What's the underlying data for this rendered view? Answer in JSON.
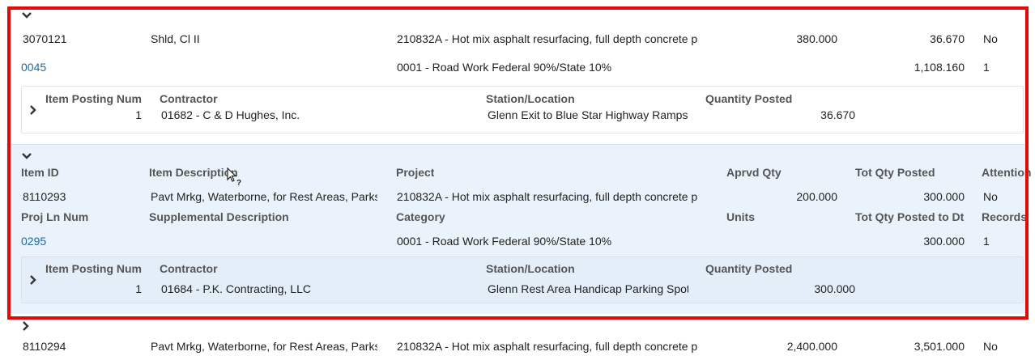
{
  "expand_glyph": "⌄",
  "collapse_glyph": "›",
  "rows": [
    {
      "item_id": "3070121",
      "item_description": "Shld, Cl II",
      "project": "210832A - Hot mix asphalt resurfacing, full depth concrete p",
      "aprvd_qty": "380.000",
      "tot_qty_posted": "36.670",
      "attention": "No",
      "proj_ln_num": "0045",
      "supplemental_description": "",
      "category": "0001 - Road Work Federal 90%/State 10%",
      "units": "",
      "tot_qty_posted_to_dt": "1,108.160",
      "records": "1",
      "posting": {
        "item_posting_num": "1",
        "contractor": "01682 - C & D Hughes, Inc.",
        "station_location": "Glenn Exit to Blue Star Highway Ramps",
        "quantity_posted": "36.670"
      }
    },
    {
      "item_id": "8110293",
      "item_description": "Pavt Mrkg, Waterborne, for Rest Areas, Parks",
      "project": "210832A - Hot mix asphalt resurfacing, full depth concrete p",
      "aprvd_qty": "200.000",
      "tot_qty_posted": "300.000",
      "attention": "No",
      "proj_ln_num": "0295",
      "supplemental_description": "",
      "category": "0001 - Road Work Federal 90%/State 10%",
      "units": "",
      "tot_qty_posted_to_dt": "300.000",
      "records": "1",
      "posting": {
        "item_posting_num": "1",
        "contractor": "01684 - P.K. Contracting, LLC",
        "station_location": "Glenn Rest Area Handicap Parking Spot",
        "quantity_posted": "300.000"
      }
    },
    {
      "item_id": "8110294",
      "item_description": "Pavt Mrkg, Waterborne, for Rest Areas, Parks",
      "project": "210832A - Hot mix asphalt resurfacing, full depth concrete p",
      "aprvd_qty": "2,400.000",
      "tot_qty_posted": "3,501.000",
      "attention": "No"
    }
  ],
  "headers": {
    "item_id": "Item ID",
    "item_description": "Item Description",
    "project": "Project",
    "aprvd_qty": "Aprvd Qty",
    "tot_qty_posted": "Tot Qty Posted",
    "attention": "Attention",
    "proj_ln_num": "Proj Ln Num",
    "supplemental_description": "Supplemental Description",
    "category": "Category",
    "units": "Units",
    "tot_qty_posted_to_dt": "Tot Qty Posted to Dt",
    "records": "Records"
  },
  "posting_headers": {
    "item_posting_num": "Item Posting Num",
    "contractor": "Contractor",
    "station_location": "Station/Location",
    "quantity_posted": "Quantity Posted"
  },
  "colors": {
    "highlight_frame": "#e00a0a",
    "selected_row_bg": "#eaf3fb",
    "link": "#1f6aa5"
  }
}
